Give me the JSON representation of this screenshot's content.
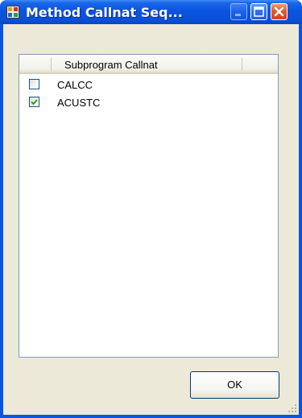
{
  "window": {
    "title": "Method Callnat Seq..."
  },
  "listview": {
    "column_header": "Subprogram Callnat",
    "rows": [
      {
        "label": "CALCC",
        "checked": false
      },
      {
        "label": "ACUSTC",
        "checked": true
      }
    ]
  },
  "buttons": {
    "ok_label": "OK"
  },
  "colors": {
    "titlebar": "#0a55e0",
    "client_background": "#ece9d8",
    "checkmark": "#21a121",
    "close_button": "#e45a32"
  }
}
